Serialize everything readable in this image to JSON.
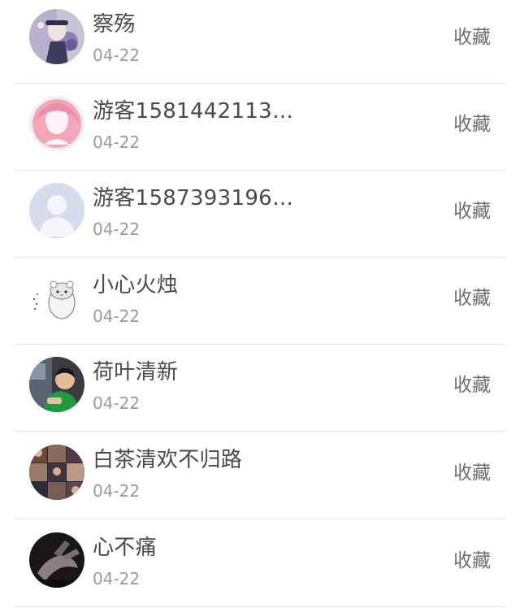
{
  "list": {
    "items": [
      {
        "name": "察殇",
        "date": "04-22",
        "action": "收藏",
        "avatar": "anime-character-avatar"
      },
      {
        "name": "游客1581442113…",
        "date": "04-22",
        "action": "收藏",
        "avatar": "pink-silhouette-avatar"
      },
      {
        "name": "游客1587393196…",
        "date": "04-22",
        "action": "收藏",
        "avatar": "default-user-avatar"
      },
      {
        "name": "小心火烛",
        "date": "04-22",
        "action": "收藏",
        "avatar": "hamster-avatar"
      },
      {
        "name": "荷叶清新",
        "date": "04-22",
        "action": "收藏",
        "avatar": "boy-photo-avatar"
      },
      {
        "name": "白茶清欢不归路",
        "date": "04-22",
        "action": "收藏",
        "avatar": "collage-avatar"
      },
      {
        "name": "心不痛",
        "date": "04-22",
        "action": "收藏",
        "avatar": "dark-hand-avatar"
      }
    ]
  }
}
